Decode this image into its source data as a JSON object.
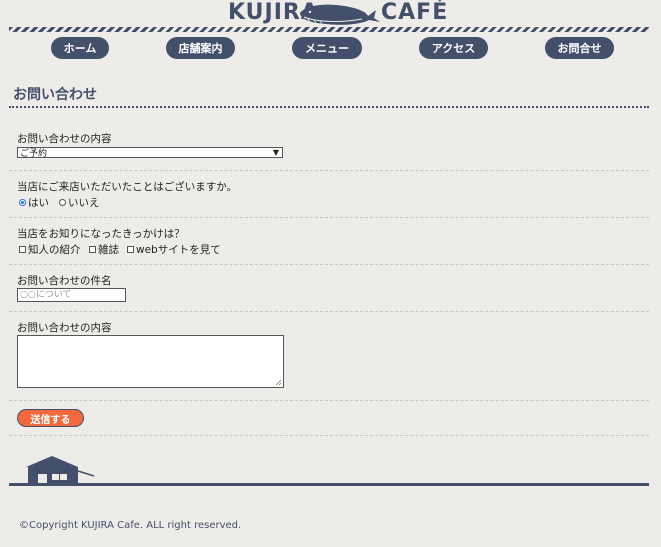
{
  "header": {
    "logo_left": "KUJIRA",
    "logo_right": "CAFÉ",
    "brand_color": "#44506b"
  },
  "nav": {
    "items": [
      {
        "label": "ホーム"
      },
      {
        "label": "店舗案内"
      },
      {
        "label": "メニュー"
      },
      {
        "label": "アクセス"
      },
      {
        "label": "お問合せ"
      }
    ]
  },
  "page": {
    "title": "お問い合わせ"
  },
  "form": {
    "inquiry_type_label": "お問い合わせの内容",
    "inquiry_type_selected": "ご予約",
    "visited_label": "当店にご来店いただいたことはございますか。",
    "visited_options": [
      "はい",
      "いいえ"
    ],
    "visited_selected": "はい",
    "source_label": "当店をお知りになったきっかけは？",
    "source_options": [
      "知人の紹介",
      "雑誌",
      "webサイトを見て"
    ],
    "subject_label": "お問い合わせの件名",
    "subject_placeholder": "○○について",
    "message_label": "お問い合わせの内容",
    "message_value": "",
    "submit_label": "送信する",
    "submit_color": "#f06a3d"
  },
  "footer": {
    "copyright": "©Copyright KUJIRA Cafe. ALL right reserved."
  }
}
